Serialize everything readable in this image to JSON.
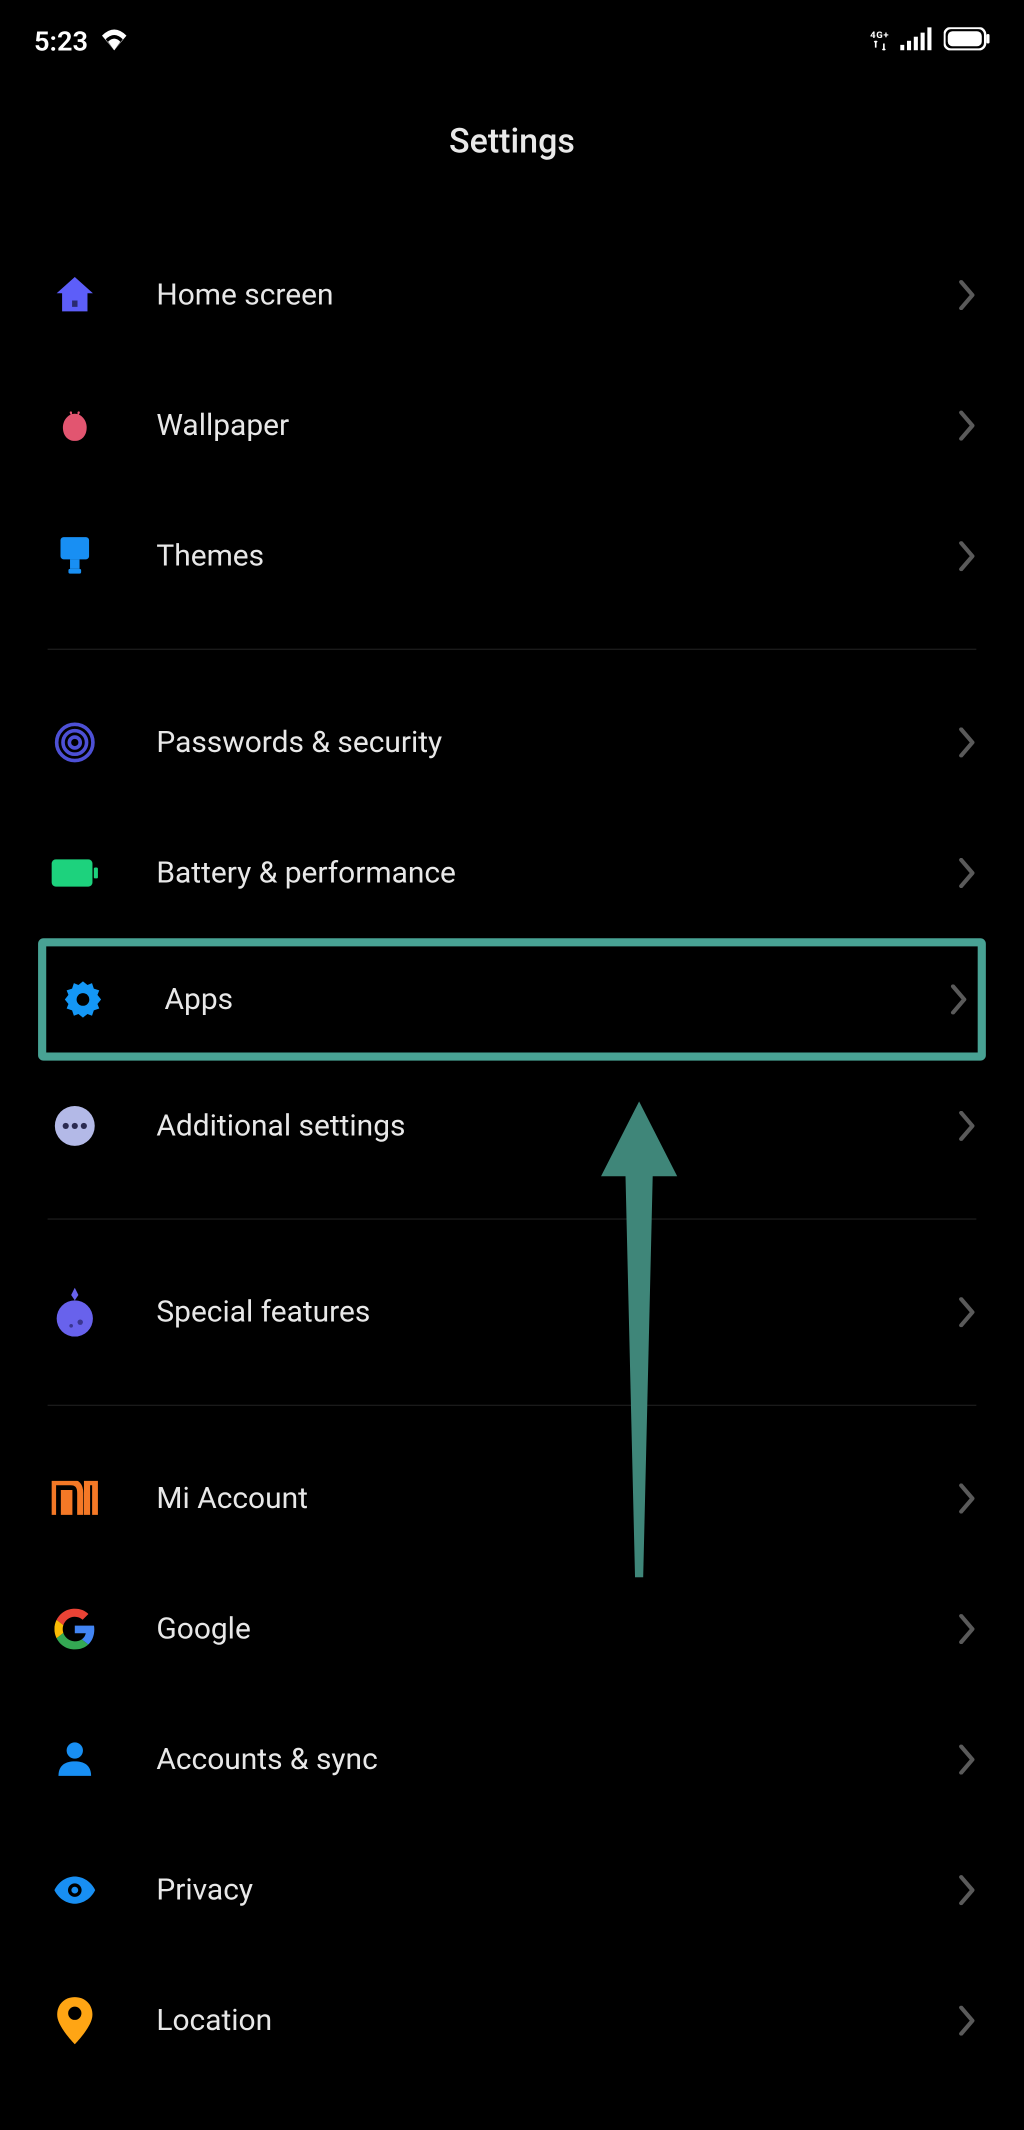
{
  "status": {
    "time": "5:23",
    "network": "4G+"
  },
  "title": "Settings",
  "groups": [
    {
      "items": [
        {
          "key": "home_screen",
          "label": "Home screen"
        },
        {
          "key": "wallpaper",
          "label": "Wallpaper"
        },
        {
          "key": "themes",
          "label": "Themes"
        }
      ]
    },
    {
      "items": [
        {
          "key": "passwords_security",
          "label": "Passwords & security"
        },
        {
          "key": "battery_performance",
          "label": "Battery & performance"
        },
        {
          "key": "apps",
          "label": "Apps",
          "highlighted": true
        },
        {
          "key": "additional_settings",
          "label": "Additional settings"
        }
      ]
    },
    {
      "items": [
        {
          "key": "special_features",
          "label": "Special features"
        }
      ]
    },
    {
      "items": [
        {
          "key": "mi_account",
          "label": "Mi Account"
        },
        {
          "key": "google",
          "label": "Google"
        },
        {
          "key": "accounts_sync",
          "label": "Accounts & sync"
        },
        {
          "key": "privacy",
          "label": "Privacy"
        },
        {
          "key": "location",
          "label": "Location"
        }
      ]
    }
  ]
}
